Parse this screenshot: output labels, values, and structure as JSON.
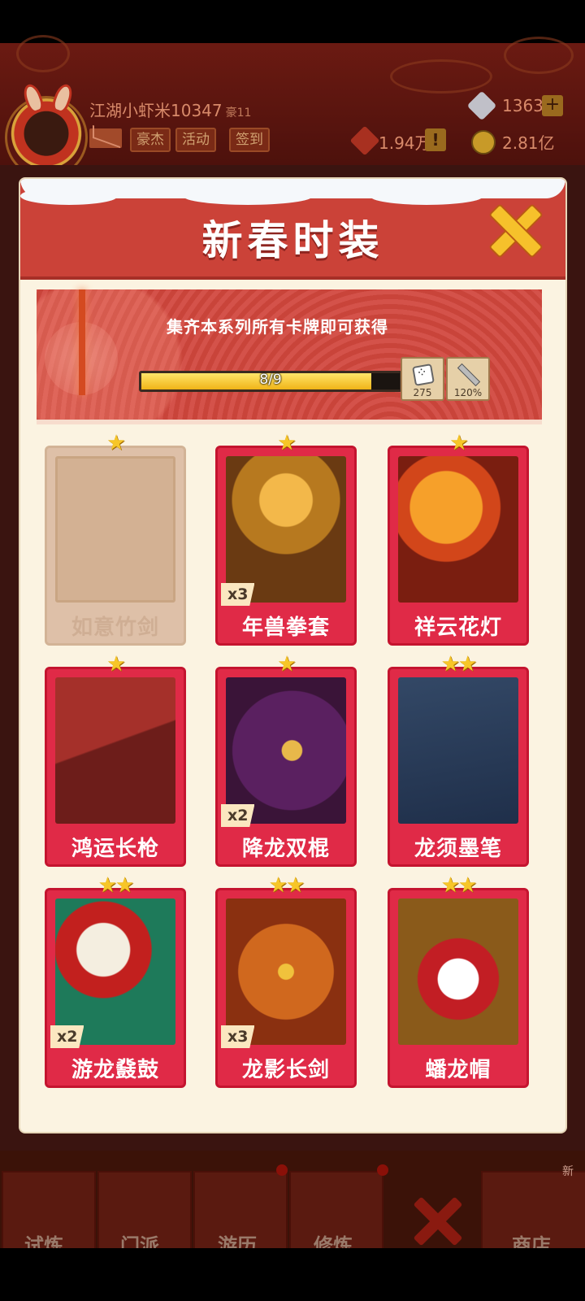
{
  "player": {
    "name": "江湖小虾米10347",
    "rank": "豪11"
  },
  "top_buttons": {
    "heroes": "豪杰",
    "activity": "活动",
    "signin": "签到"
  },
  "resources": {
    "gems": "1363",
    "power": "1.94万",
    "coins": "2.81亿"
  },
  "modal": {
    "title": "新春时装",
    "banner_text": "集齐本系列所有卡牌即可获得",
    "progress_text": "8/9",
    "progress_value": 0.889,
    "bonuses": [
      {
        "icon": "dice-icon",
        "value": "275"
      },
      {
        "icon": "sword-icon",
        "value": "120%"
      }
    ]
  },
  "cards": [
    {
      "name": "如意竹剑",
      "stars": "★",
      "count": "",
      "locked": true
    },
    {
      "name": "年兽拳套",
      "stars": "★",
      "count": "x3",
      "locked": false
    },
    {
      "name": "祥云花灯",
      "stars": "★",
      "count": "",
      "locked": false
    },
    {
      "name": "鸿运长枪",
      "stars": "★",
      "count": "",
      "locked": false
    },
    {
      "name": "降龙双棍",
      "stars": "★",
      "count": "x2",
      "locked": false
    },
    {
      "name": "龙须墨笔",
      "stars": "★★",
      "count": "",
      "locked": false
    },
    {
      "name": "游龙鼗鼓",
      "stars": "★★",
      "count": "x2",
      "locked": false
    },
    {
      "name": "龙影长剑",
      "stars": "★★",
      "count": "x3",
      "locked": false
    },
    {
      "name": "蟠龙帽",
      "stars": "★★",
      "count": "",
      "locked": false
    }
  ],
  "nav": {
    "tabs": [
      "试炼",
      "门派",
      "游历",
      "修炼",
      "商店"
    ],
    "new_badge": "新"
  },
  "colors": {
    "card_red": "#e02a47",
    "header_red": "#cb4238",
    "gold": "#f7c628"
  }
}
